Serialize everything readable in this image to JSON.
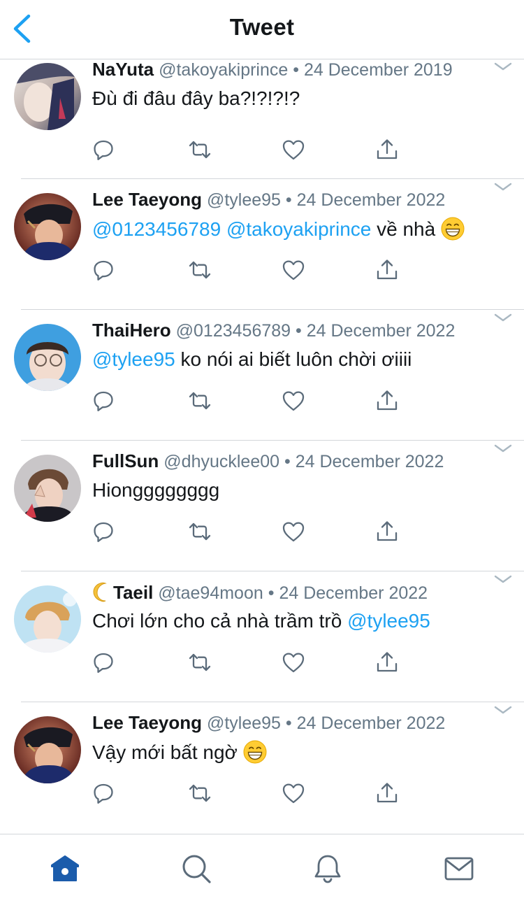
{
  "header": {
    "title": "Tweet",
    "back_icon": "chevron-left-icon"
  },
  "colors": {
    "mention": "#1da1f2",
    "secondary_text": "#657786",
    "accent": "#1b5cab"
  },
  "tweets": [
    {
      "name": "NaYuta",
      "handle": "@takoyakiprince",
      "separator": "•",
      "date": "24 December 2019",
      "text": "Đù đi đâu đây ba?!?!?!?"
    },
    {
      "name": "Lee Taeyong",
      "handle": "@tylee95",
      "separator": "•",
      "date": "24 December 2022",
      "mention1": "@0123456789",
      "mention2": "@takoyakiprince",
      "text": "về nhà",
      "emoji": "grinning-face-emoji"
    },
    {
      "name": "ThaiHero",
      "handle": "@0123456789",
      "separator": "•",
      "date": "24 December 2022",
      "mention1": "@tylee95",
      "text": "ko nói ai biết luôn chời ơiiii"
    },
    {
      "name": "FullSun",
      "handle": "@dhyucklee00",
      "separator": "•",
      "date": "24 December 2022",
      "text": "Hiongggggggg"
    },
    {
      "name": "Taeil",
      "name_prefix_icon": "crescent-moon-emoji",
      "handle": "@tae94moon",
      "separator": "•",
      "date": "24 December 2022",
      "text": "Chơi lớn cho cả nhà trầm trồ",
      "mention1": "@tylee95"
    },
    {
      "name": "Lee Taeyong",
      "handle": "@tylee95",
      "separator": "•",
      "date": "24 December 2022",
      "text": "Vậy mới bất ngờ",
      "emoji": "grinning-face-emoji"
    }
  ],
  "actions": [
    "reply-icon",
    "retweet-icon",
    "like-icon",
    "share-icon"
  ],
  "tabbar": [
    "home-icon",
    "search-icon",
    "notifications-icon",
    "messages-icon"
  ]
}
